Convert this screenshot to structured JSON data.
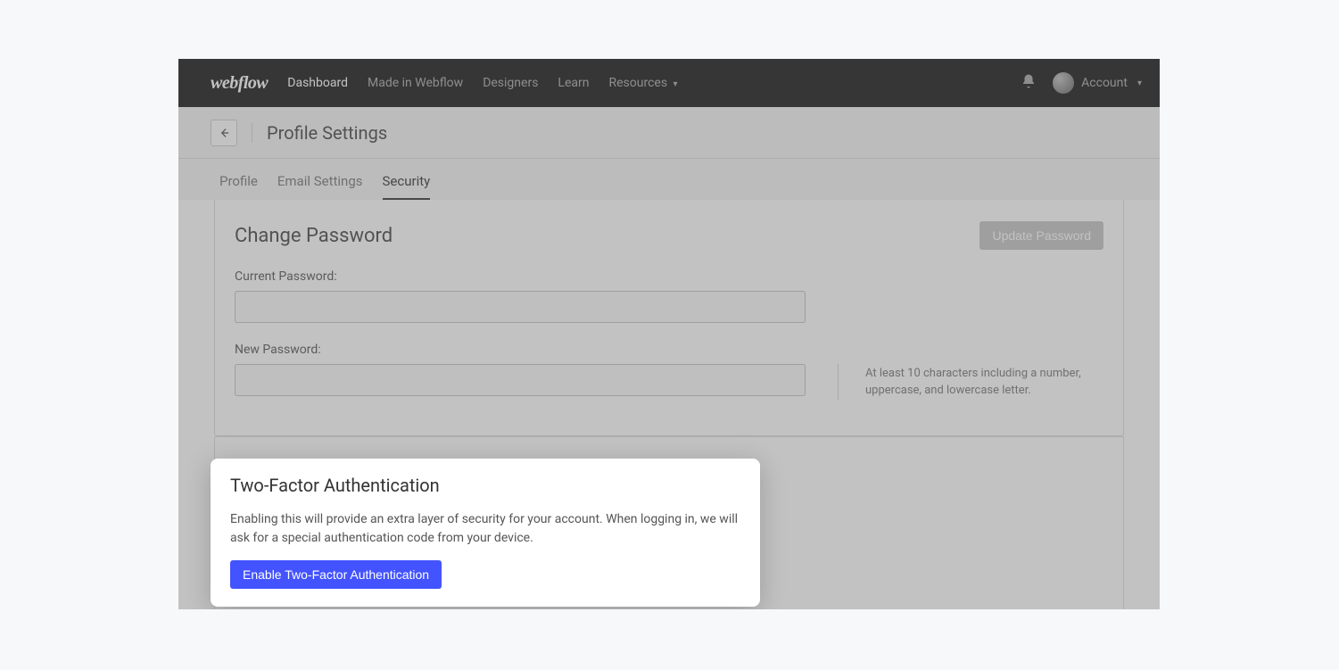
{
  "brand": "webflow",
  "nav": {
    "dashboard": "Dashboard",
    "made_in": "Made in Webflow",
    "designers": "Designers",
    "learn": "Learn",
    "resources": "Resources",
    "account": "Account"
  },
  "header": {
    "title": "Profile Settings"
  },
  "tabs": {
    "profile": "Profile",
    "email": "Email Settings",
    "security": "Security"
  },
  "change_password": {
    "title": "Change Password",
    "update_btn": "Update Password",
    "current_label": "Current Password:",
    "new_label": "New Password:",
    "hint": "At least 10 characters including a number, uppercase, and lowercase letter."
  },
  "two_factor": {
    "title": "Two-Factor Authentication",
    "desc": "Enabling this will provide an extra layer of security for your account. When logging in, we will ask for a special authentication code from your device.",
    "enable_btn": "Enable Two-Factor Authentication"
  }
}
